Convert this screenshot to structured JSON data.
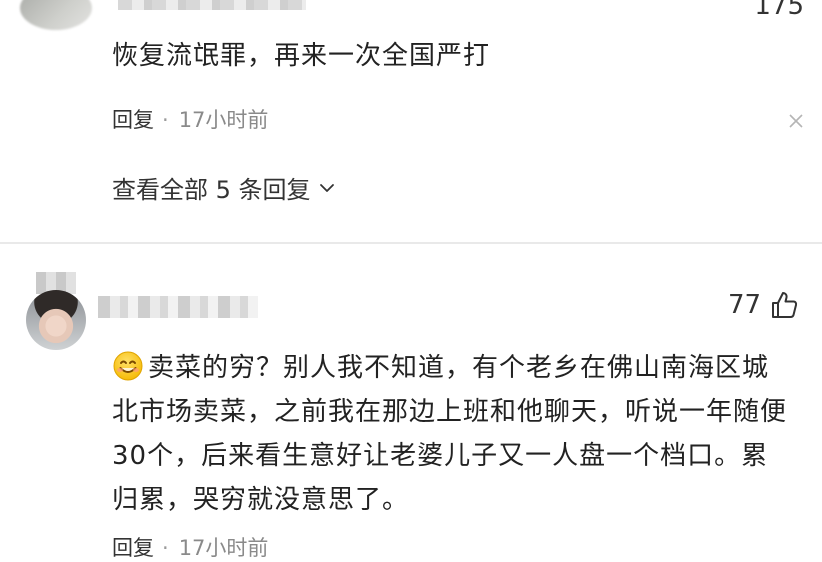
{
  "top_comment": {
    "likes": "175",
    "text": "恢复流氓罪，再来一次全国严打",
    "reply_label": "回复",
    "time": "17小时前",
    "view_replies_label": "查看全部 5 条回复"
  },
  "second_comment": {
    "likes": "77",
    "line1": "卖菜的穷？别人我不知道，有个老乡在佛山南海区城",
    "line2": "北市场卖菜，之前我在那边上班和他聊天，听说一年随便",
    "line3": "30个，后来看生意好让老婆儿子又一人盘一个档口。累",
    "line4": "归累，哭穷就没意思了。",
    "reply_label": "回复",
    "time": "17小时前"
  },
  "icons": {
    "close": "close-icon",
    "chevron": "chevron-down-icon",
    "thumb": "thumbs-up-icon",
    "emoji": "smiley-emoji-icon"
  }
}
